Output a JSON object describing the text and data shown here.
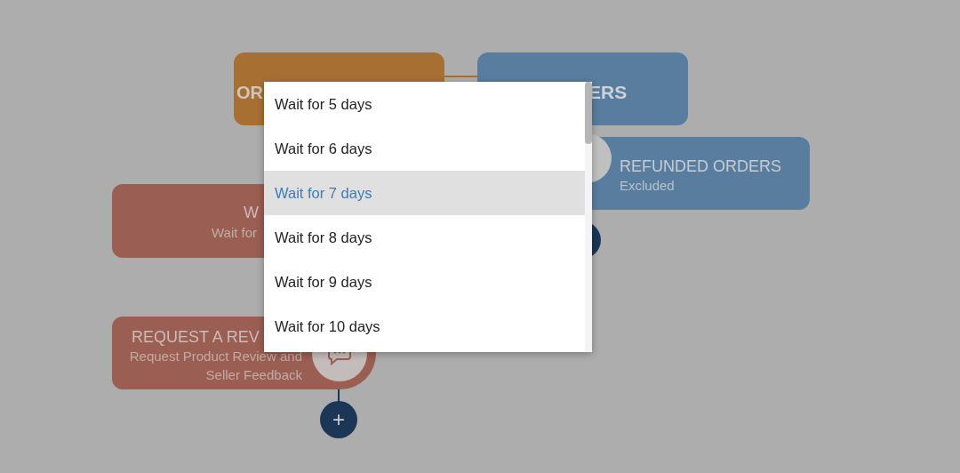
{
  "nodes": [
    {
      "kind": "trigger",
      "title": "OR"
    },
    {
      "kind": "filter",
      "title": "ERS"
    },
    {
      "kind": "filter-detail",
      "title": "REFUNDED ORDERS",
      "lines": [
        "Excluded"
      ]
    },
    {
      "kind": "wait",
      "title": "W",
      "lines": [
        "Wait for"
      ]
    },
    {
      "kind": "action",
      "title": "REQUEST A REV",
      "lines": [
        "Request Product Review and",
        "Seller Feedback"
      ]
    }
  ],
  "add_buttons": [
    {
      "label": "+"
    }
  ],
  "dropdown": {
    "options": [
      {
        "label": "Wait for 5 days",
        "selected": false
      },
      {
        "label": "Wait for 6 days",
        "selected": false
      },
      {
        "label": "Wait for 7 days",
        "selected": true
      },
      {
        "label": "Wait for 8 days",
        "selected": false
      },
      {
        "label": "Wait for 9 days",
        "selected": false
      },
      {
        "label": "Wait for 10 days",
        "selected": false
      }
    ]
  }
}
